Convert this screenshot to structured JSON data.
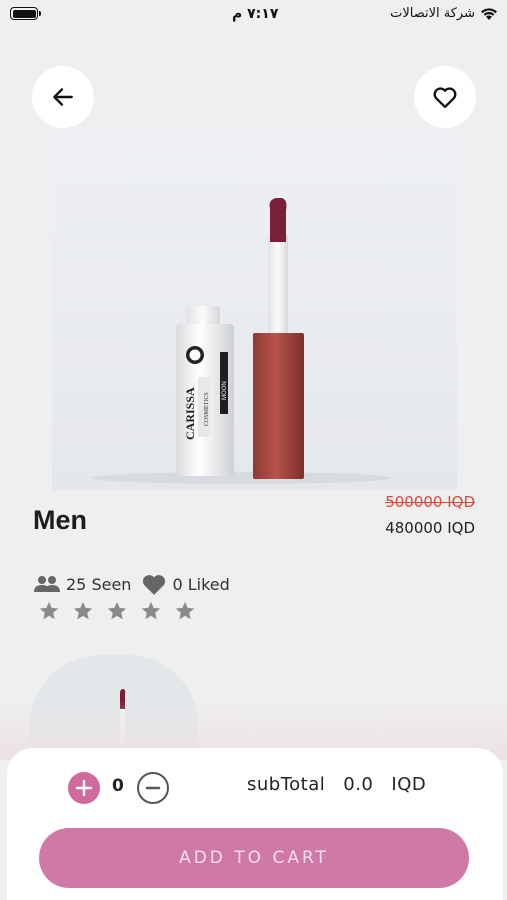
{
  "status_bar": {
    "time": "٧:١٧ م",
    "carrier": "شركة الاتصالات",
    "battery_icon": "battery-icon",
    "wifi_icon": "wifi-icon"
  },
  "header": {
    "back_icon": "arrow-left-icon",
    "favorite_icon": "heart-outline-icon"
  },
  "product": {
    "name": "Men",
    "old_price": "500000 IQD",
    "new_price": "480000 IQD",
    "image_brand_text": "CARISSA",
    "image_brand_subtext": "COSMETICS",
    "image_shade_text": "MOON",
    "seen": "25 Seen",
    "liked": "0 Liked",
    "rating": 0,
    "rating_max": 5
  },
  "cart": {
    "quantity": "0",
    "subtotal_label": "subTotal",
    "subtotal_value": "0.0",
    "currency": "IQD",
    "add_to_cart_label": "ADD TO CART"
  },
  "colors": {
    "accent": "#cf79a6",
    "plus_button": "#d06a9e",
    "old_price": "#e2473b",
    "background": "#efefef"
  }
}
